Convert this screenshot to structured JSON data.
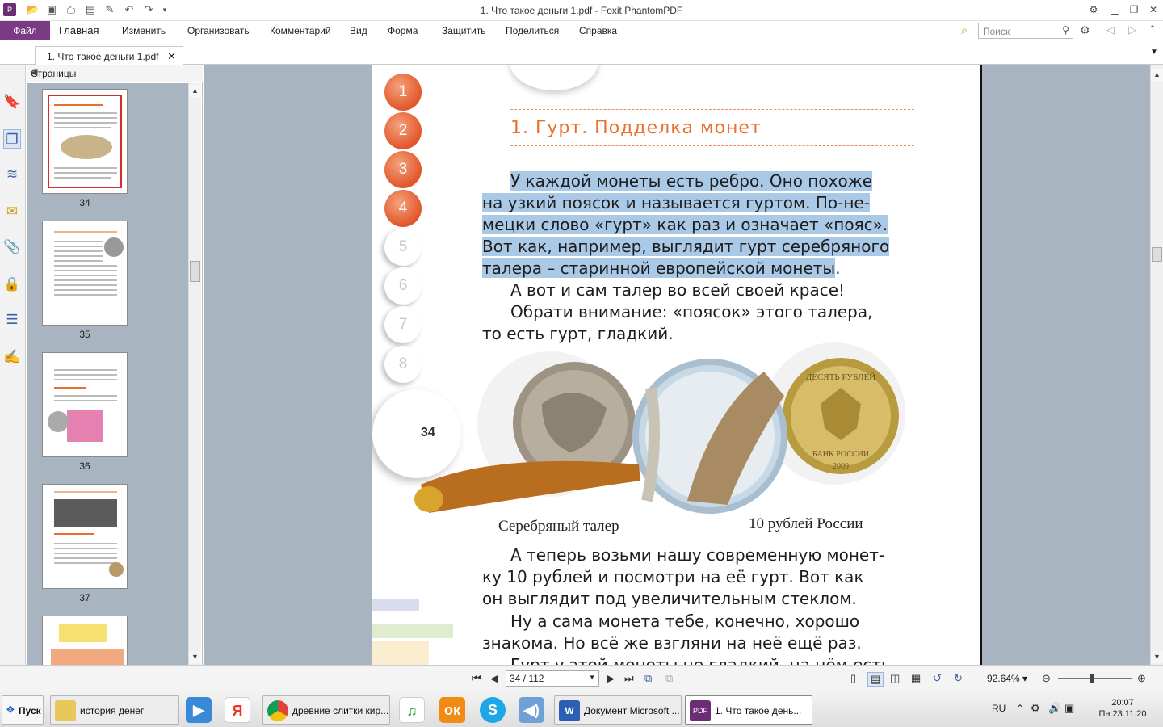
{
  "window": {
    "title": "1. Что такое деньги 1.pdf - Foxit PhantomPDF"
  },
  "menu": {
    "file": "Файл",
    "items": [
      "Главная",
      "Изменить",
      "Организовать",
      "Комментарий",
      "Вид",
      "Форма",
      "Защитить",
      "Поделиться",
      "Справка"
    ],
    "search_placeholder": "Поиск"
  },
  "tab": {
    "label": "1. Что такое деньги 1.pdf"
  },
  "panel": {
    "title": "Страницы",
    "thumbnails": [
      "34",
      "35",
      "36",
      "37"
    ],
    "selected": "34"
  },
  "page": {
    "circles": [
      "1",
      "2",
      "3",
      "4",
      "5",
      "6",
      "7",
      "8"
    ],
    "page_number": "34",
    "chapter_title": "1.  Гурт.  Подделка  монет",
    "para1": [
      "У  каждой  монеты  есть  ребро.  Оно  похоже",
      "на  узкий  поясок  и  называется  гуртом.  По-не-",
      "мецки  слово  «гурт»  как  раз  и  означает  «пояс».",
      "Вот  как,  например,  выглядит  гурт  серебряного",
      "талера  –  старинной  европейской  монеты",
      "."
    ],
    "para2": [
      "А  вот  и  сам  талер  во  всей  своей  красе!",
      "Обрати  внимание:  «поясок»  этого  талера,",
      "то  есть  гурт,  гладкий."
    ],
    "caption_left": "Серебряный  талер",
    "caption_right": "10  рублей  России",
    "coin_text": {
      "top": "ДЕСЯТЬ РУБЛЕЙ",
      "bottom": "БАНК РОССИИ",
      "year": "2009"
    },
    "para3": [
      "А  теперь  возьми  нашу  современную  монет-",
      "ку  10  рублей  и  посмотри  на  её  гурт.  Вот  как",
      "он  выглядит  под  увеличительным  стеклом.",
      "Ну  а  сама  монета  тебе,  конечно,  хорошо",
      "знакома.  Но  всё  же  взгляни  на  неё  ещё  раз.",
      "Гурт  у  этой  монеты  не  гладкий,  на  нём  есть"
    ]
  },
  "status": {
    "page_field": "34 / 112",
    "zoom": "92.64%"
  },
  "taskbar": {
    "start": "Пуск",
    "buttons": [
      "история денег",
      "древние слитки кир...",
      "Документ Microsoft ...",
      "1. Что такое день..."
    ],
    "lang": "RU",
    "time": "20:07",
    "date": "Пн 23.11.20"
  },
  "colors": {
    "accent": "#7b3a84",
    "chapter": "#e8702b",
    "highlight": "#aac9e6",
    "thumb_bg": "#a8b4bf"
  }
}
